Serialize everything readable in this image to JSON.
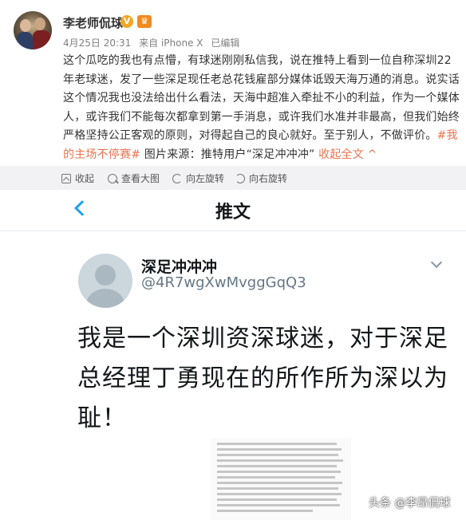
{
  "post": {
    "author": "李老师侃球",
    "verified_icon": "v-badge-icon",
    "member_icon": "crown-badge-icon",
    "date": "4月25日 20:31",
    "source": "来自 iPhone X",
    "edited": "已编辑",
    "text_main": "这个瓜吃的我也有点懵，有球迷刚刚私信我，说在推特上看到一位自称深圳22年老球迷，发了一些深足现任老总花钱雇部分媒体诋毁天海万通的消息。说实话这个情况我也没法给出什么看法，天海中超准入牵扯不小的利益，作为一个媒体人，或许我们不能每次都拿到第一手消息，或许我们水准并非最高，但我们始终严格坚持公正客观的原则，对得起自己的良心就好。至于别人，不做评价。",
    "hashtag": "#我的主场不停赛#",
    "image_source": " 图片来源：推特用户“深足冲冲冲” ",
    "collapse_link": "收起全文 ^"
  },
  "toolbar": {
    "collapse": "收起",
    "view_large": "查看大图",
    "rotate_left": "向左旋转",
    "rotate_right": "向右旋转"
  },
  "tweet": {
    "nav_title": "推文",
    "name": "深足冲冲冲",
    "handle": "@4R7wgXwMvggGqQ3",
    "text": "我是一个深圳资深球迷，对于深足总经理丁勇现在的所作所为深以为耻！"
  },
  "watermark": "头条 @李昂侃球",
  "colors": {
    "link": "#eb7350",
    "twitter_blue": "#1da1f2",
    "toolbar_bg": "#f2f2f5"
  }
}
